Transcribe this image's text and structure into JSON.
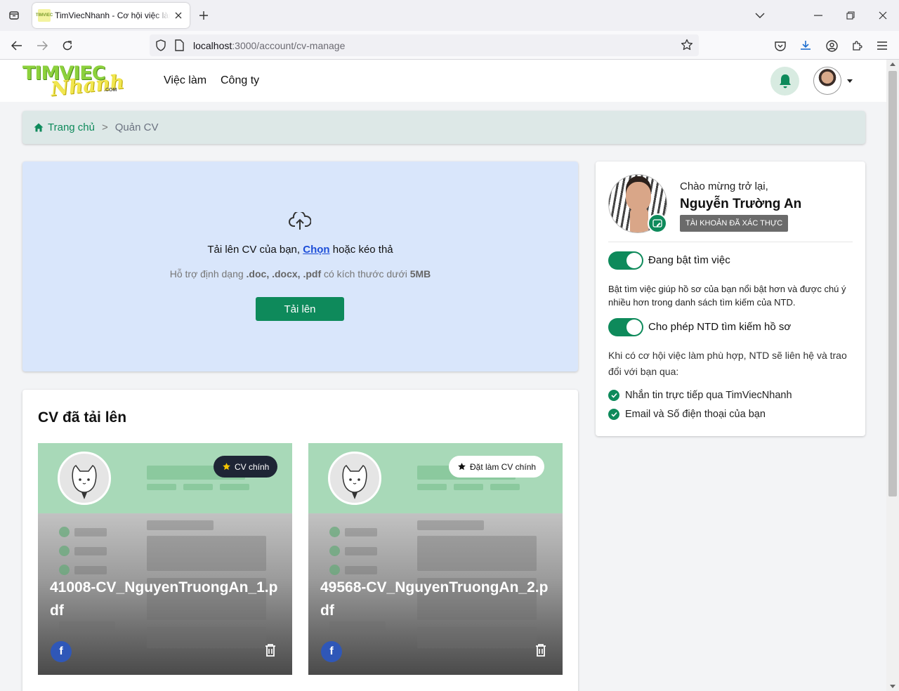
{
  "browser": {
    "tab_title": "TimViecNhanh - Cơ hội việc làm",
    "favicon_text": "TIMVIEC",
    "url_host": "localhost",
    "url_rest": ":3000/account/cv-manage"
  },
  "header": {
    "logo_main": "TIMVIEC",
    "logo_script": "Nhanh",
    "logo_com": ".COM",
    "nav": [
      "Việc làm",
      "Công ty"
    ]
  },
  "breadcrumb": {
    "home": "Trang chủ",
    "sep": ">",
    "current": "Quản CV"
  },
  "upload": {
    "title_prefix": "Tải lên CV của bạn, ",
    "choose": "Chọn",
    "title_suffix": " hoặc kéo thả",
    "hint_prefix": "Hỗ trợ định dạng ",
    "hint_formats": ".doc, .docx, .pdf",
    "hint_middle": " có kích thước dưới ",
    "hint_size": "5MB",
    "button": "Tải lên"
  },
  "cv_list": {
    "title": "CV đã tải lên",
    "items": [
      {
        "name": "41008-CV_NguyenTruongAn_1.pdf",
        "badge": "CV chính",
        "is_main": true,
        "share": "f"
      },
      {
        "name": "49568-CV_NguyenTruongAn_2.pdf",
        "badge": "Đặt làm CV chính",
        "is_main": false,
        "share": "f"
      }
    ]
  },
  "profile": {
    "welcome": "Chào mừng trở lại,",
    "name": "Nguyễn Trường An",
    "verified": "TÀI KHOẢN ĐÃ XÁC THỰC",
    "toggle_job_search": {
      "label": "Đang bật tìm việc",
      "on": true
    },
    "job_search_desc": "Bật tìm việc giúp hồ sơ của bạn nổi bật hơn và được chú ý nhiều hơn trong danh sách tìm kiếm của NTD.",
    "toggle_allow_search": {
      "label": "Cho phép NTD tìm kiếm hồ sơ",
      "on": true
    },
    "contact_desc": "Khi có cơ hội việc làm phù hợp, NTD sẽ liên hệ và trao đổi với bạn qua:",
    "contact_methods": [
      "Nhắn tin trực tiếp qua TimViecNhanh",
      "Email và Số điện thoại của bạn"
    ]
  },
  "colors": {
    "brand_green": "#0e8a5b",
    "upload_bg": "#d9e6fb",
    "badge_dark": "#1e2535",
    "link_blue": "#1d4ed8"
  }
}
